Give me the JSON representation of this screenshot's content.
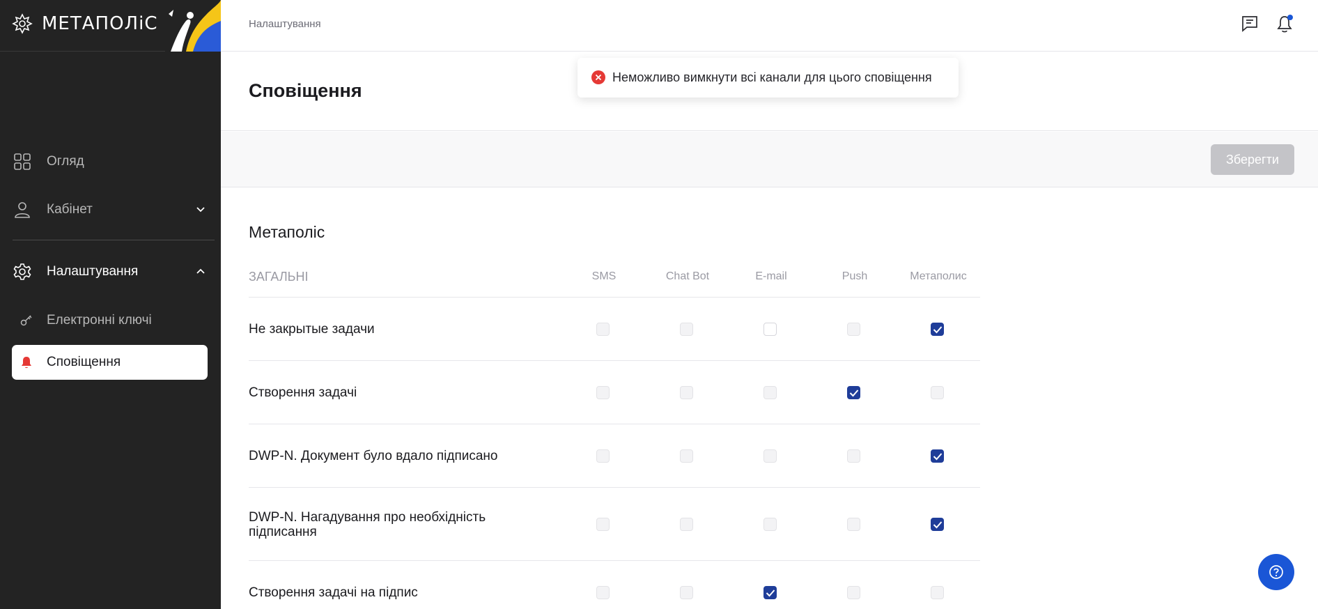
{
  "logo": {
    "text": "МЕТАПОЛіС"
  },
  "sidebar": {
    "items": [
      {
        "label": "Огляд",
        "icon": "grid-icon"
      },
      {
        "label": "Кабінет",
        "icon": "user-icon"
      },
      {
        "label": "Налаштування",
        "icon": "gear-icon"
      }
    ],
    "subitems": [
      {
        "label": "Електронні ключі",
        "icon": "key-icon"
      },
      {
        "label": "Сповіщення",
        "icon": "bell-icon",
        "accent": "#e53935"
      }
    ]
  },
  "header": {
    "breadcrumb": "Налаштування"
  },
  "page": {
    "title": "Сповіщення"
  },
  "toast": {
    "message": "Неможливо вимкнути всі канали для цього сповіщення",
    "icon": "error-icon",
    "color": "#e53935"
  },
  "toolbar": {
    "save_label": "Зберегти"
  },
  "section": {
    "title": "Метаполіс",
    "group": "ЗАГАЛЬНІ",
    "columns": [
      "SMS",
      "Chat Bot",
      "E-mail",
      "Push",
      "Метаполис"
    ],
    "rows": [
      {
        "label": "Не закрытые задачи",
        "states": [
          "disabled",
          "disabled",
          "empty",
          "disabled",
          "checked"
        ]
      },
      {
        "label": "Створення задачі",
        "states": [
          "disabled",
          "disabled",
          "disabled",
          "checked",
          "disabled"
        ]
      },
      {
        "label": "DWP-N. Документ було вдало підписано",
        "states": [
          "disabled",
          "disabled",
          "disabled",
          "disabled",
          "checked"
        ]
      },
      {
        "label": "DWP-N. Нагадування про необхідність підписання",
        "states": [
          "disabled",
          "disabled",
          "disabled",
          "disabled",
          "checked"
        ]
      },
      {
        "label": "Створення задачі на підпис",
        "states": [
          "disabled",
          "disabled",
          "checked",
          "disabled",
          "disabled"
        ]
      }
    ]
  },
  "colors": {
    "sidebar_bg": "#232323",
    "checkbox_checked": "#1f3d99",
    "help_button": "#1a56d6"
  }
}
